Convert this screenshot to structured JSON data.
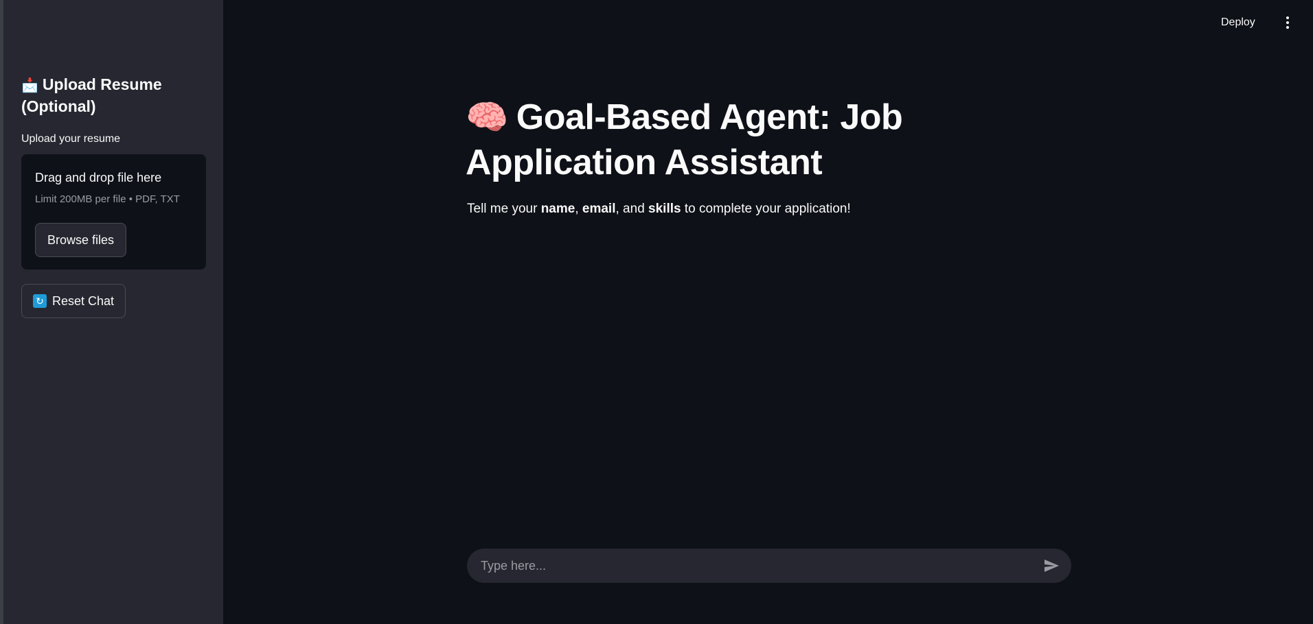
{
  "header": {
    "deploy_label": "Deploy",
    "menu_icon": "kebab-menu-icon"
  },
  "sidebar": {
    "title_emoji": "📩",
    "title": "Upload Resume (Optional)",
    "upload_label": "Upload your resume",
    "dropzone": {
      "title": "Drag and drop file here",
      "limit": "Limit 200MB per file • PDF, TXT",
      "browse_label": "Browse files"
    },
    "reset_icon_glyph": "🔄",
    "reset_label": "Reset Chat"
  },
  "main": {
    "title_emoji": "🧠",
    "title": "Goal-Based Agent: Job Application Assistant",
    "subtitle": {
      "p1": "Tell me your ",
      "b1": "name",
      "p2": ", ",
      "b2": "email",
      "p3": ", and ",
      "b3": "skills",
      "p4": " to complete your application!"
    }
  },
  "chat": {
    "placeholder": "Type here...",
    "send_icon": "send-icon"
  },
  "colors": {
    "background": "#0e1117",
    "sidebar": "#262730",
    "text": "#fafafa",
    "muted": "#9a9ca3",
    "reset_icon": "#1f9bd8"
  }
}
